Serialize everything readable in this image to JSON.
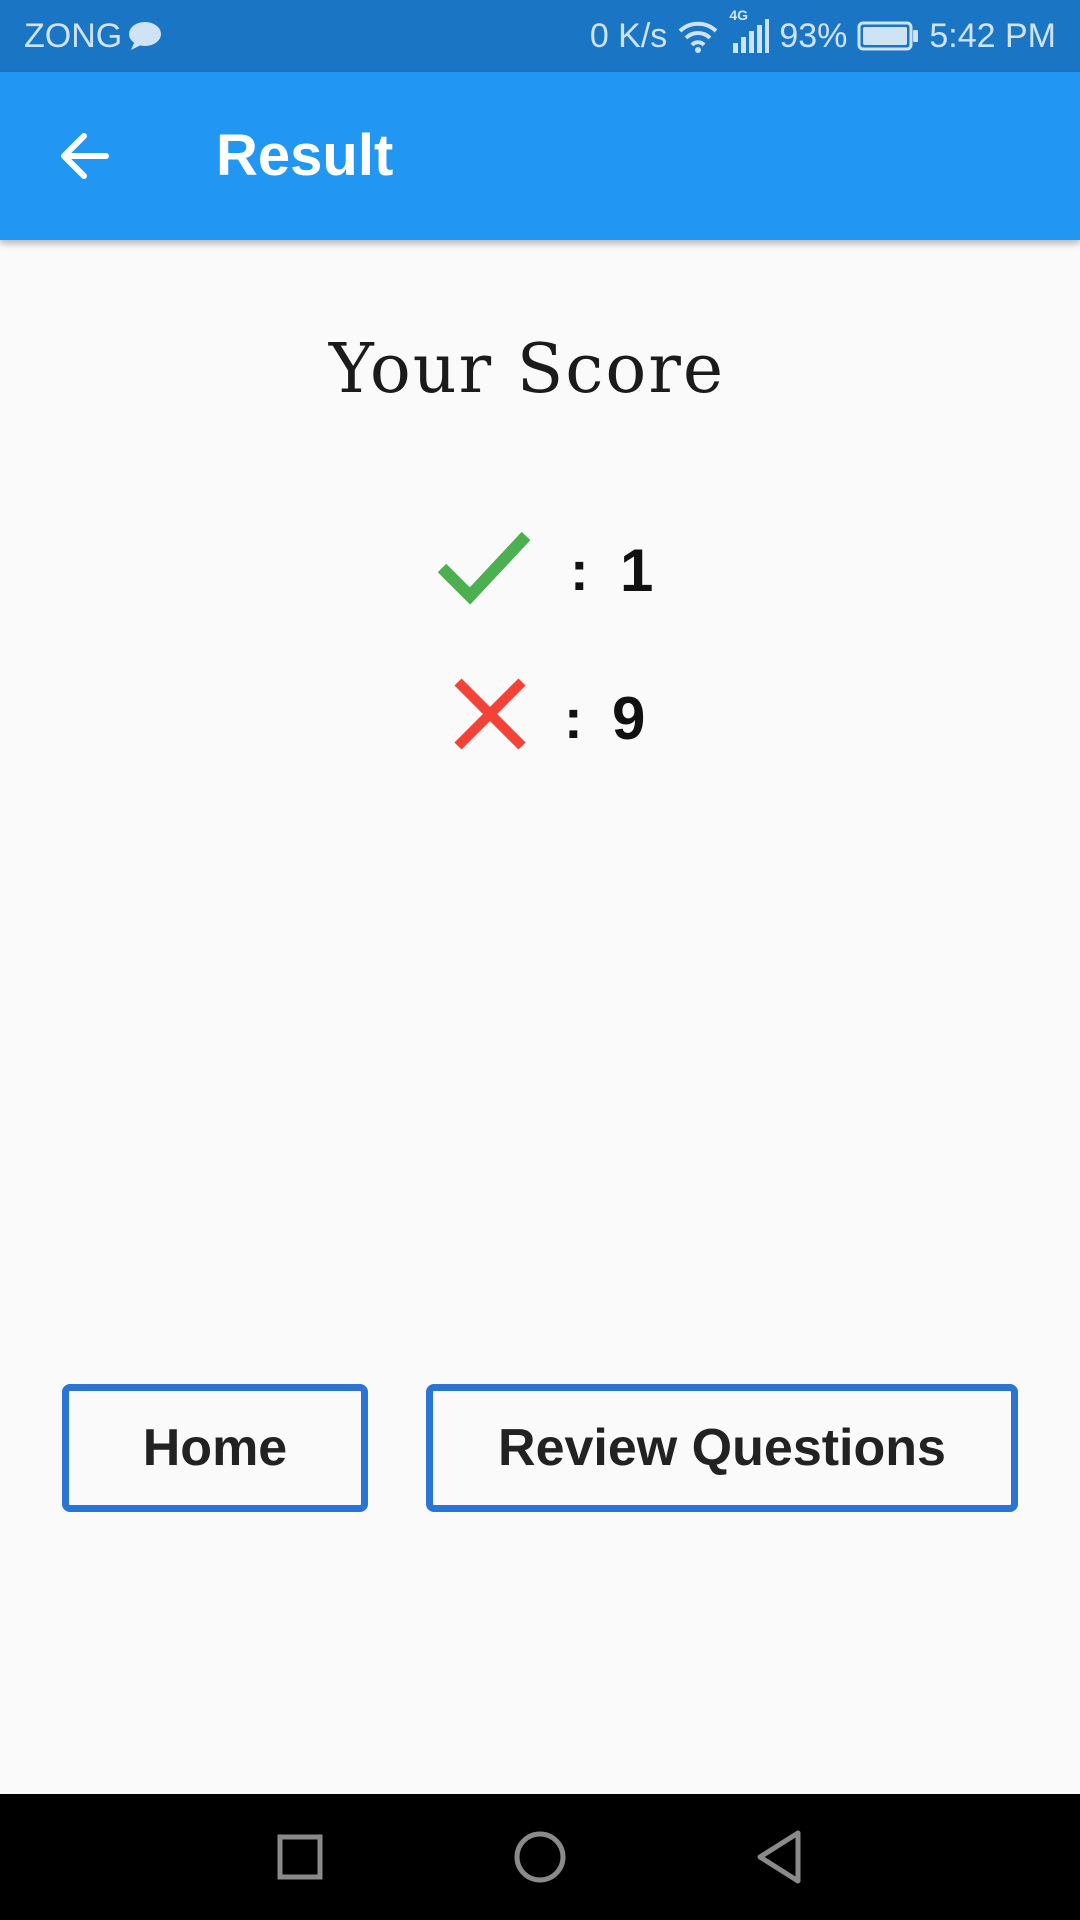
{
  "status_bar": {
    "carrier": "ZONG",
    "network_speed": "0 K/s",
    "network_type": "4G",
    "battery": "93%",
    "time": "5:42 PM"
  },
  "app_bar": {
    "title": "Result",
    "back_icon": "arrow-back-icon",
    "color": "#2196f3"
  },
  "score": {
    "title": "Your Score",
    "correct": {
      "icon": "check-icon",
      "separator": ":",
      "value": "1",
      "color": "#4caf50"
    },
    "wrong": {
      "icon": "close-icon",
      "separator": ":",
      "value": "9",
      "color": "#f44336"
    }
  },
  "buttons": {
    "home_label": "Home",
    "review_label": "Review Questions",
    "border_color": "#2a74d4"
  },
  "nav_bar": {
    "items": [
      "recents-square-icon",
      "home-circle-icon",
      "back-triangle-icon"
    ]
  }
}
